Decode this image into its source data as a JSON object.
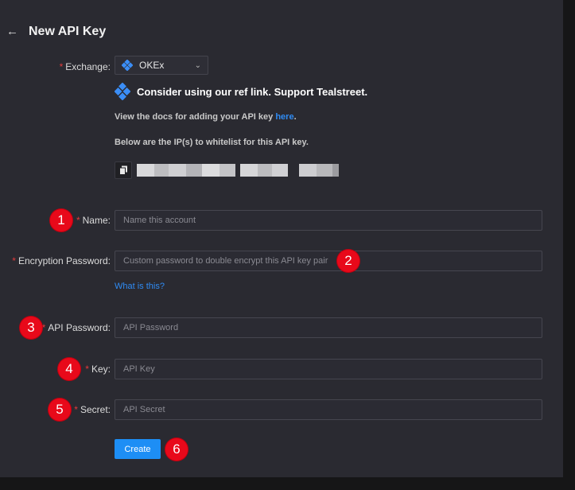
{
  "header": {
    "title": "New API Key",
    "back_icon": "arrow-left-icon"
  },
  "form": {
    "exchange": {
      "label": "Exchange",
      "value": "OKEx",
      "icon": "okx-diamond-icon"
    },
    "ref_banner": "Consider using our ref link. Support Tealstreet.",
    "docs": {
      "text": "View the docs for adding your API key ",
      "link": "here",
      "suffix": "."
    },
    "ip_note": "Below are the IP(s) to whitelist for this API key.",
    "name": {
      "label": "Name",
      "placeholder": "Name this account"
    },
    "encryption": {
      "label": "Encryption Password",
      "placeholder": "Custom password to double encrypt this API key pair",
      "help_link": "What is this?"
    },
    "api_password": {
      "label": "API Password",
      "placeholder": "API Password"
    },
    "key": {
      "label": "Key",
      "placeholder": "API Key"
    },
    "secret": {
      "label": "Secret",
      "placeholder": "API Secret"
    },
    "create_button": "Create",
    "required_mark": "*",
    "colon": ":"
  },
  "markers": [
    "1",
    "2",
    "3",
    "4",
    "5",
    "6"
  ],
  "colors": {
    "accent": "#1d8ef5",
    "required": "#e23b3b",
    "marker": "#e8091a",
    "panel": "#2a2a31"
  }
}
